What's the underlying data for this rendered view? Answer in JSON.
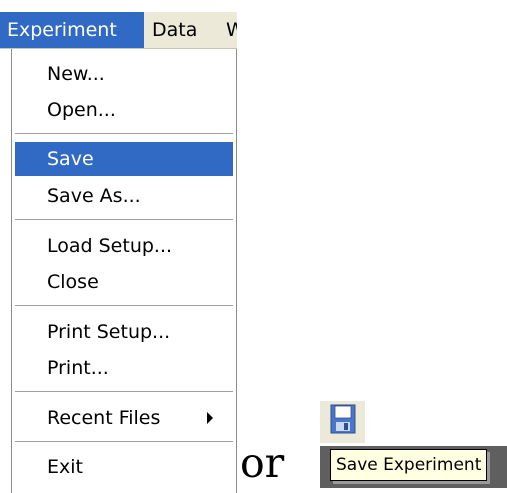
{
  "menubar": {
    "items": [
      {
        "label": "Experiment"
      },
      {
        "label": "Data"
      },
      {
        "label": "W"
      }
    ]
  },
  "menu": {
    "items": [
      {
        "label": "New..."
      },
      {
        "label": "Open..."
      },
      {
        "label": "Save"
      },
      {
        "label": "Save As..."
      },
      {
        "label": "Load Setup..."
      },
      {
        "label": "Close"
      },
      {
        "label": "Print Setup..."
      },
      {
        "label": "Print..."
      },
      {
        "label": "Recent Files"
      },
      {
        "label": "Exit"
      }
    ],
    "highlighted": "Save"
  },
  "connector_text": "or",
  "toolbar": {
    "save_icon": "floppy-disk-icon",
    "tooltip": "Save Experiment"
  },
  "colors": {
    "highlight": "#316ac5",
    "menubar_bg": "#ece9d8",
    "tooltip_bg": "#ffffe1"
  }
}
